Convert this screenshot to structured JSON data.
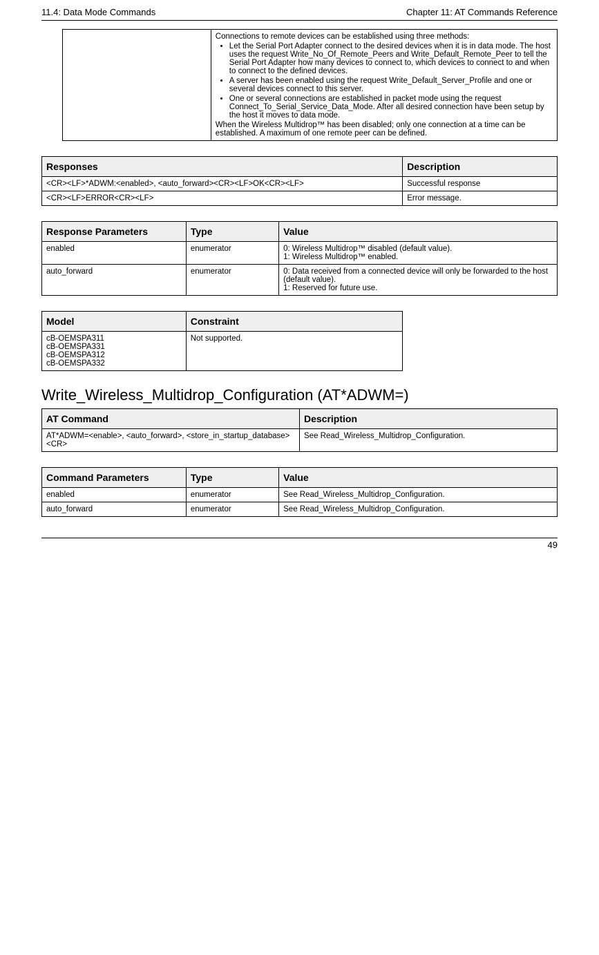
{
  "header": {
    "left": "11.4: Data Mode Commands",
    "right": "Chapter 11: AT Commands Reference"
  },
  "topTable": {
    "cell_intro": "Connections to remote devices can be established using three methods:",
    "bullets": [
      "Let the Serial Port Adapter connect to the desired devices when it is in data mode. The host uses the request Write_No_Of_Remote_Peers and Write_Default_Remote_Peer to tell the Serial Port Adapter how many devices to connect to, which devices to connect to and when to connect to the defined devices.",
      "A server has been enabled using the request Write_Default_Server_Profile and one or several devices connect to this server.",
      "One or several connections are established in packet mode using the request Connect_To_Serial_Service_Data_Mode. After all desired connection have been setup by the host it moves to data mode."
    ],
    "cell_outro": "When the Wireless Multidrop™ has been disabled; only one connection at a time can be established. A maximum of one remote peer can be defined."
  },
  "responsesTable": {
    "headers": {
      "c1": "Responses",
      "c2": "Description"
    },
    "rows": [
      {
        "c1": "<CR><LF>*ADWM:<enabled>, <auto_forward><CR><LF>OK<CR><LF>",
        "c2": "Successful response"
      },
      {
        "c1": "<CR><LF>ERROR<CR><LF>",
        "c2": "Error message."
      }
    ]
  },
  "respParamsTable": {
    "headers": {
      "c1": "Response Parameters",
      "c2": "Type",
      "c3": "Value"
    },
    "rows": [
      {
        "c1": "enabled",
        "c2": "enumerator",
        "c3": "0: Wireless Multidrop™ disabled (default value).\n1: Wireless Multidrop™ enabled."
      },
      {
        "c1": "auto_forward",
        "c2": "enumerator",
        "c3": "0: Data received from a connected device will only be forwarded to the host (default value).\n1: Reserved for future use."
      }
    ]
  },
  "modelTable": {
    "headers": {
      "c1": "Model",
      "c2": "Constraint"
    },
    "rows": [
      {
        "c1": "cB-OEMSPA311\ncB-OEMSPA331\ncB-OEMSPA312\ncB-OEMSPA332",
        "c2": "Not supported."
      }
    ]
  },
  "sectionTitle": "Write_Wireless_Multidrop_Configuration (AT*ADWM=)",
  "atCmdTable": {
    "headers": {
      "c1": "AT Command",
      "c2": "Description"
    },
    "rows": [
      {
        "c1": "AT*ADWM=<enable>, <auto_forward>, <store_in_startup_database><CR>",
        "c2": "See Read_Wireless_Multidrop_Configuration."
      }
    ]
  },
  "cmdParamsTable": {
    "headers": {
      "c1": "Command Parameters",
      "c2": "Type",
      "c3": "Value"
    },
    "rows": [
      {
        "c1": "enabled",
        "c2": "enumerator",
        "c3": "See Read_Wireless_Multidrop_Configuration."
      },
      {
        "c1": "auto_forward",
        "c2": "enumerator",
        "c3": "See Read_Wireless_Multidrop_Configuration."
      }
    ]
  },
  "footer": {
    "pageNum": "49"
  }
}
